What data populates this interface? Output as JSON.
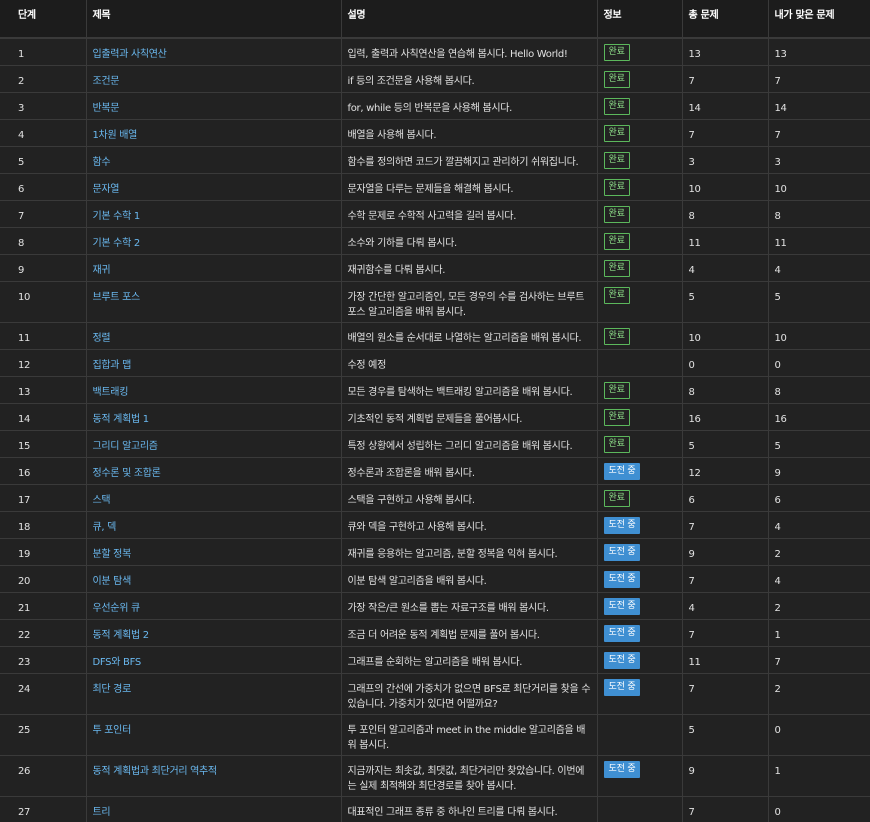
{
  "headers": {
    "step": "단계",
    "title": "제목",
    "desc": "설명",
    "info": "정보",
    "total": "총 문제",
    "mine": "내가 맞은 문제"
  },
  "status_labels": {
    "done": "완료",
    "trying": "도전 중"
  },
  "colors": {
    "link": "#6ab8ef",
    "done": "#5cb85c",
    "trying": "#3f8fd2",
    "background": "#212121"
  },
  "rows": [
    {
      "step": "1",
      "title": "입출력과 사칙연산",
      "desc": "입력, 출력과 사칙연산을 연습해 봅시다. Hello World!",
      "status": "done",
      "total": "13",
      "mine": "13"
    },
    {
      "step": "2",
      "title": "조건문",
      "desc": "if 등의 조건문을 사용해 봅시다.",
      "status": "done",
      "total": "7",
      "mine": "7"
    },
    {
      "step": "3",
      "title": "반복문",
      "desc": "for, while 등의 반복문을 사용해 봅시다.",
      "status": "done",
      "total": "14",
      "mine": "14"
    },
    {
      "step": "4",
      "title": "1차원 배열",
      "desc": "배열을 사용해 봅시다.",
      "status": "done",
      "total": "7",
      "mine": "7"
    },
    {
      "step": "5",
      "title": "함수",
      "desc": "함수를 정의하면 코드가 깔끔해지고 관리하기 쉬워집니다.",
      "status": "done",
      "total": "3",
      "mine": "3"
    },
    {
      "step": "6",
      "title": "문자열",
      "desc": "문자열을 다루는 문제들을 해결해 봅시다.",
      "status": "done",
      "total": "10",
      "mine": "10"
    },
    {
      "step": "7",
      "title": "기본 수학 1",
      "desc": "수학 문제로 수학적 사고력을 길러 봅시다.",
      "status": "done",
      "total": "8",
      "mine": "8"
    },
    {
      "step": "8",
      "title": "기본 수학 2",
      "desc": "소수와 기하를 다뤄 봅시다.",
      "status": "done",
      "total": "11",
      "mine": "11"
    },
    {
      "step": "9",
      "title": "재귀",
      "desc": "재귀함수를 다뤄 봅시다.",
      "status": "done",
      "total": "4",
      "mine": "4"
    },
    {
      "step": "10",
      "title": "브루트 포스",
      "desc": "가장 간단한 알고리즘인, 모든 경우의 수를 검사하는 브루트 포스 알고리즘을 배워 봅시다.",
      "status": "done",
      "total": "5",
      "mine": "5",
      "tall": true
    },
    {
      "step": "11",
      "title": "정렬",
      "desc": "배열의 원소를 순서대로 나열하는 알고리즘을 배워 봅시다.",
      "status": "done",
      "total": "10",
      "mine": "10"
    },
    {
      "step": "12",
      "title": "집합과 맵",
      "desc": "수정 예정",
      "status": "",
      "total": "0",
      "mine": "0"
    },
    {
      "step": "13",
      "title": "백트래킹",
      "desc": "모든 경우를 탐색하는 백트래킹 알고리즘을 배워 봅시다.",
      "status": "done",
      "total": "8",
      "mine": "8"
    },
    {
      "step": "14",
      "title": "동적 계획법 1",
      "desc": "기초적인 동적 계획법 문제들을 풀어봅시다.",
      "status": "done",
      "total": "16",
      "mine": "16"
    },
    {
      "step": "15",
      "title": "그리디 알고리즘",
      "desc": "특정 상황에서 성립하는 그리디 알고리즘을 배워 봅시다.",
      "status": "done",
      "total": "5",
      "mine": "5"
    },
    {
      "step": "16",
      "title": "정수론 및 조합론",
      "desc": "정수론과 조합론을 배워 봅시다.",
      "status": "trying",
      "total": "12",
      "mine": "9"
    },
    {
      "step": "17",
      "title": "스택",
      "desc": "스택을 구현하고 사용해 봅시다.",
      "status": "done",
      "total": "6",
      "mine": "6"
    },
    {
      "step": "18",
      "title": "큐, 덱",
      "desc": "큐와 덱을 구현하고 사용해 봅시다.",
      "status": "trying",
      "total": "7",
      "mine": "4"
    },
    {
      "step": "19",
      "title": "분할 정복",
      "desc": "재귀를 응용하는 알고리즘, 분할 정복을 익혀 봅시다.",
      "status": "trying",
      "total": "9",
      "mine": "2"
    },
    {
      "step": "20",
      "title": "이분 탐색",
      "desc": "이분 탐색 알고리즘을 배워 봅시다.",
      "status": "trying",
      "total": "7",
      "mine": "4"
    },
    {
      "step": "21",
      "title": "우선순위 큐",
      "desc": "가장 작은/큰 원소를 뽑는 자료구조를 배워 봅시다.",
      "status": "trying",
      "total": "4",
      "mine": "2"
    },
    {
      "step": "22",
      "title": "동적 계획법 2",
      "desc": "조금 더 어려운 동적 계획법 문제를 풀어 봅시다.",
      "status": "trying",
      "total": "7",
      "mine": "1"
    },
    {
      "step": "23",
      "title": "DFS와 BFS",
      "desc": "그래프를 순회하는 알고리즘을 배워 봅시다.",
      "status": "trying",
      "total": "11",
      "mine": "7"
    },
    {
      "step": "24",
      "title": "최단 경로",
      "desc": "그래프의 간선에 가중치가 없으면 BFS로 최단거리를 찾을 수 있습니다. 가중치가 있다면 어떨까요?",
      "status": "trying",
      "total": "7",
      "mine": "2",
      "tall": true
    },
    {
      "step": "25",
      "title": "투 포인터",
      "desc": "투 포인터 알고리즘과 meet in the middle 알고리즘을 배워 봅시다.",
      "status": "",
      "total": "5",
      "mine": "0",
      "tall": true
    },
    {
      "step": "26",
      "title": "동적 계획법과 최단거리 역추적",
      "desc": "지금까지는 최솟값, 최댓값, 최단거리만 찾았습니다. 이번에는 실제 최적해와 최단경로를 찾아 봅시다.",
      "status": "trying",
      "total": "9",
      "mine": "1",
      "tall": true
    },
    {
      "step": "27",
      "title": "트리",
      "desc": "대표적인 그래프 종류 중 하나인 트리를 다뤄 봅시다.",
      "status": "",
      "total": "7",
      "mine": "0"
    }
  ]
}
